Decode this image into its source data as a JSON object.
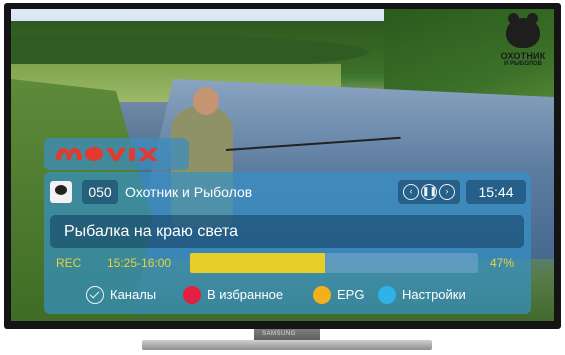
{
  "channel_logo": {
    "line1": "ОХОТНИК",
    "line2": "И РЫБОЛОВ"
  },
  "brand": {
    "name": "MOVIX",
    "color": "#e23a31"
  },
  "info_bar": {
    "channel_number": "050",
    "channel_name": "Охотник и Рыболов",
    "controls": [
      "prev-icon",
      "pause-icon",
      "next-icon"
    ],
    "clock": "15:44",
    "program_title": "Рыбалка на краю света",
    "rec_label": "REC",
    "program_time": "15:25-16:00",
    "progress_percent": 47,
    "progress_label": "47%"
  },
  "actions": [
    {
      "icon": "checkmark-icon",
      "label": "Каналы",
      "color": "transparent"
    },
    {
      "icon": "red-button-icon",
      "label": "В избранное",
      "color": "#e3203f"
    },
    {
      "icon": "yellow-button-icon",
      "label": "EPG",
      "color": "#f2b11a"
    },
    {
      "icon": "blue-button-icon",
      "label": "Настройки",
      "color": "#2fb3e6"
    }
  ],
  "tv": {
    "brand": "SAMSUNG"
  },
  "colors": {
    "accent_yellow": "#e6cd27",
    "panel_blue": "#3492c8"
  }
}
